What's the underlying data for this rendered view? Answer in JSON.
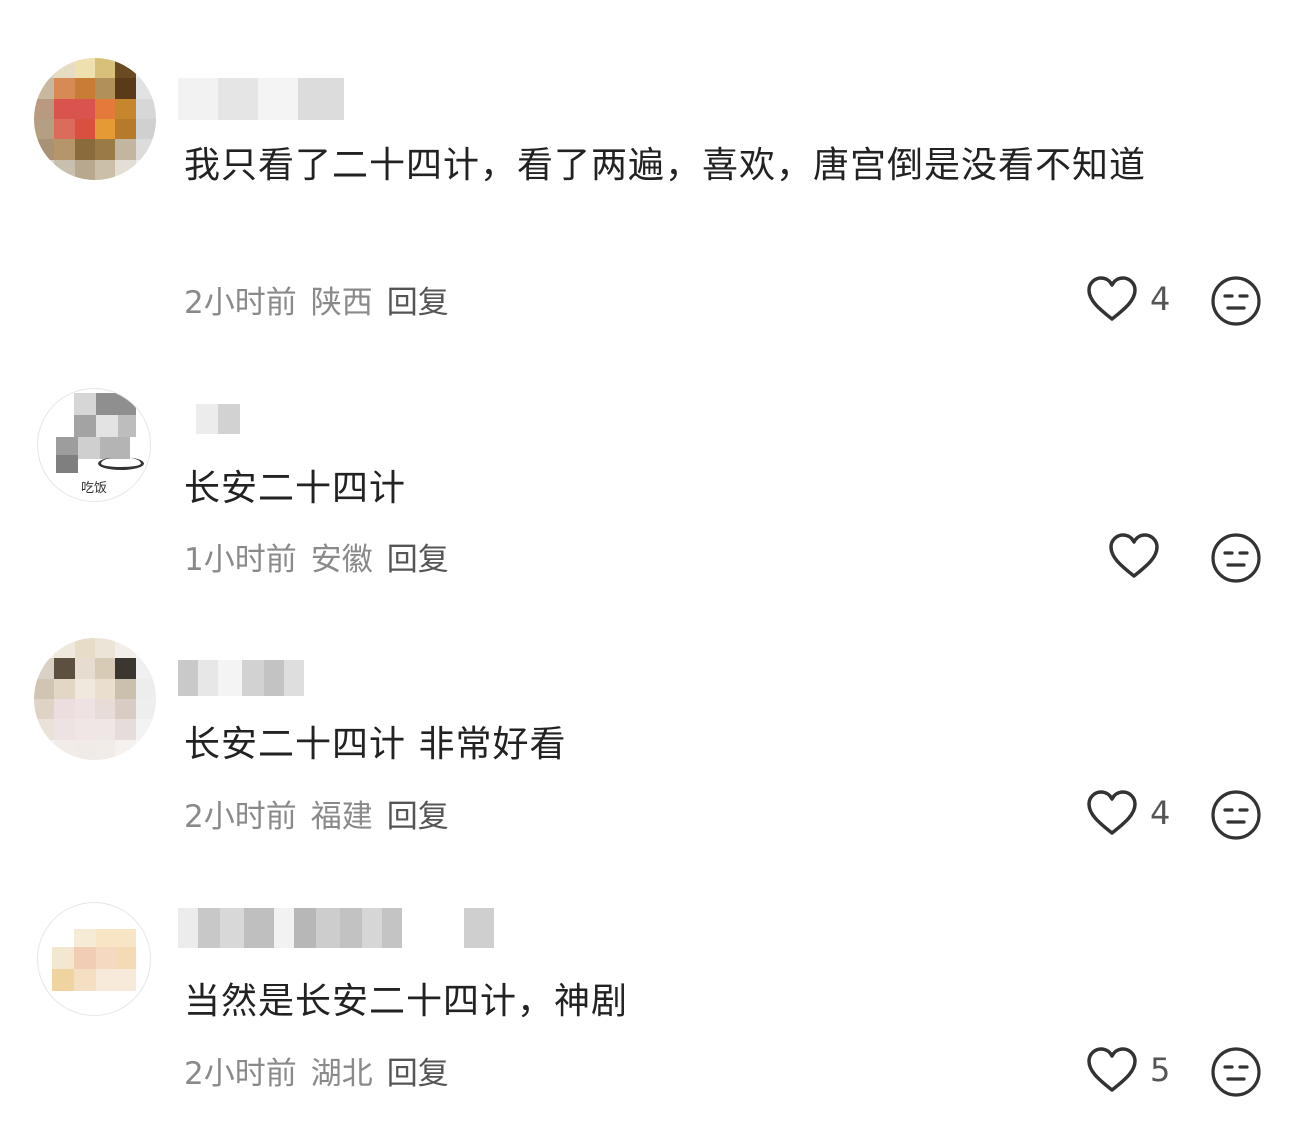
{
  "comments": [
    {
      "text": "我只看了二十四计，看了两遍，喜欢，唐宫倒是没看不知道",
      "time": "2小时前",
      "location": "陕西",
      "reply": "回复",
      "likes": "4"
    },
    {
      "text": "长安二十四计",
      "time": "1小时前",
      "location": "安徽",
      "reply": "回复",
      "likes": "",
      "avatar_caption": "吃饭"
    },
    {
      "text": "长安二十四计 非常好看",
      "time": "2小时前",
      "location": "福建",
      "reply": "回复",
      "likes": "4"
    },
    {
      "text": "当然是长安二十四计，神剧",
      "time": "2小时前",
      "location": "湖北",
      "reply": "回复",
      "likes": "5"
    }
  ],
  "icons": {
    "like": "heart-outline-icon",
    "dislike": "neutral-face-icon"
  },
  "colors": {
    "text": "#222222",
    "meta": "#8a8a8a",
    "icon": "#333333"
  }
}
